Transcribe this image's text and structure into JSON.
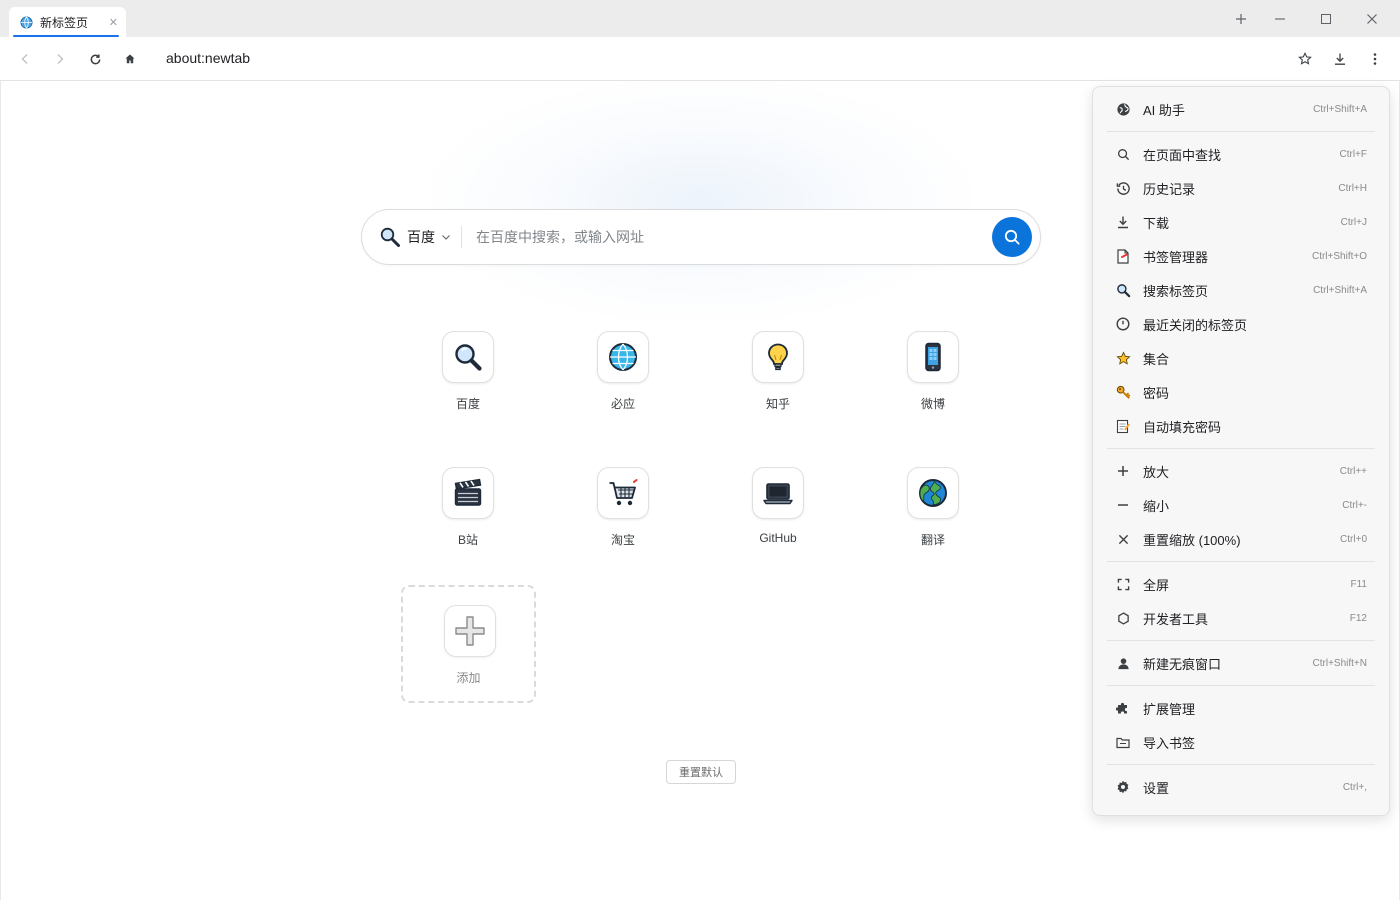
{
  "tab": {
    "title": "新标签页"
  },
  "address_bar": {
    "url": "about:newtab"
  },
  "search": {
    "engine": "百度",
    "placeholder": "在百度中搜索，或输入网址"
  },
  "shortcuts": [
    {
      "label": "百度",
      "icon": "magnifier-icon"
    },
    {
      "label": "必应",
      "icon": "globe-icon"
    },
    {
      "label": "知乎",
      "icon": "lightbulb-icon"
    },
    {
      "label": "微博",
      "icon": "phone-icon"
    },
    {
      "label": "B站",
      "icon": "clapperboard-icon"
    },
    {
      "label": "淘宝",
      "icon": "shopping-cart-icon"
    },
    {
      "label": "GitHub",
      "icon": "laptop-icon"
    },
    {
      "label": "翻译",
      "icon": "earth-icon"
    }
  ],
  "add_tile": {
    "label": "添加"
  },
  "reset_button": {
    "label": "重置默认"
  },
  "colors": {
    "accent": "#0a74da",
    "tab_indicator": "#1a73e8"
  },
  "menu": {
    "items": [
      {
        "label": "AI 助手",
        "shortcut": "Ctrl+Shift+A",
        "icon": "ai-assistant-icon"
      },
      {
        "label": "在页面中查找",
        "shortcut": "Ctrl+F",
        "icon": "search-icon"
      },
      {
        "label": "历史记录",
        "shortcut": "Ctrl+H",
        "icon": "history-icon"
      },
      {
        "label": "下载",
        "shortcut": "Ctrl+J",
        "icon": "download-icon"
      },
      {
        "label": "书签管理器",
        "shortcut": "Ctrl+Shift+O",
        "icon": "bookmark-manager-icon"
      },
      {
        "label": "搜索标签页",
        "shortcut": "Ctrl+Shift+A",
        "icon": "magnifier-icon"
      },
      {
        "label": "最近关闭的标签页",
        "shortcut": "",
        "icon": "clock-icon"
      },
      {
        "label": "集合",
        "shortcut": "",
        "icon": "star-icon"
      },
      {
        "label": "密码",
        "shortcut": "",
        "icon": "key-icon"
      },
      {
        "label": "自动填充密码",
        "shortcut": "",
        "icon": "memo-icon"
      },
      {
        "label": "放大",
        "shortcut": "Ctrl++",
        "icon": "plus-icon"
      },
      {
        "label": "缩小",
        "shortcut": "Ctrl+-",
        "icon": "minus-icon"
      },
      {
        "label": "重置缩放 (100%)",
        "shortcut": "Ctrl+0",
        "icon": "close-icon"
      },
      {
        "label": "全屏",
        "shortcut": "F11",
        "icon": "fullscreen-icon"
      },
      {
        "label": "开发者工具",
        "shortcut": "F12",
        "icon": "hexagon-icon"
      },
      {
        "label": "新建无痕窗口",
        "shortcut": "Ctrl+Shift+N",
        "icon": "person-icon"
      },
      {
        "label": "扩展管理",
        "shortcut": "",
        "icon": "puzzle-icon"
      },
      {
        "label": "导入书签",
        "shortcut": "",
        "icon": "folder-icon"
      },
      {
        "label": "设置",
        "shortcut": "Ctrl+,",
        "icon": "gear-icon"
      }
    ]
  }
}
